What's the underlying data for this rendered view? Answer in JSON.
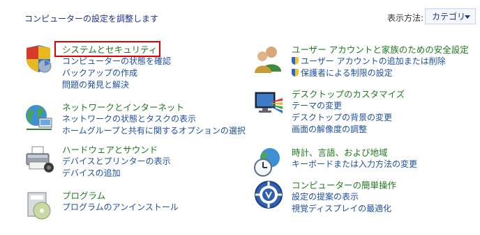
{
  "header": {
    "title": "コンピューターの設定を調整します",
    "view_by_label": "表示方法:",
    "view_by_value": "カテゴリ"
  },
  "categories": {
    "system": {
      "icon": "shield-security-icon",
      "links": [
        "システムとセキュリティ",
        "コンピューターの状態を確認",
        "バックアップの作成",
        "問題の発見と解決"
      ]
    },
    "network": {
      "icon": "network-globe-icon",
      "links": [
        "ネットワークとインターネット",
        "ネットワークの状態とタスクの表示",
        "ホームグループと共有に関するオプションの選択"
      ]
    },
    "hardware": {
      "icon": "printer-icon",
      "links": [
        "ハードウェアとサウンド",
        "デバイスとプリンターの表示",
        "デバイスの追加"
      ]
    },
    "programs": {
      "icon": "program-disc-icon",
      "links": [
        "プログラム",
        "プログラムのアンインストール"
      ]
    },
    "users": {
      "icon": "users-icon",
      "links": [
        "ユーザー アカウントと家族のための安全設定",
        "ユーザー アカウントの追加または削除",
        "保護者による制限の設定"
      ]
    },
    "appearance": {
      "icon": "monitor-palette-icon",
      "links": [
        "デスクトップのカスタマイズ",
        "テーマの変更",
        "デスクトップの背景の変更",
        "画面の解像度の調整"
      ]
    },
    "clock": {
      "icon": "clock-globe-icon",
      "links": [
        "時計、言語、および地域",
        "キーボードまたは入力方法の変更"
      ]
    },
    "ease": {
      "icon": "ease-of-access-icon",
      "links": [
        "コンピューターの簡単操作",
        "設定の提案の表示",
        "視覚ディスプレイの最適化"
      ]
    }
  },
  "colors": {
    "heading": "#1e7a1e",
    "link": "#1e50a0",
    "highlight": "#e00000"
  }
}
